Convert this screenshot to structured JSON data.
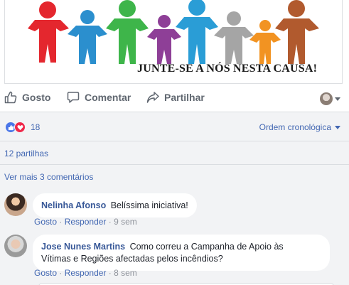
{
  "post": {
    "image_caption": "JUNTE-SE A NÓS NESTA CAUSA!"
  },
  "actions": {
    "like_label": "Gosto",
    "comment_label": "Comentar",
    "share_label": "Partilhar"
  },
  "reactions": {
    "count": "18",
    "order_label": "Ordem cronológica"
  },
  "shares": {
    "label": "12 partilhas"
  },
  "comments": {
    "more_label": "Ver mais 3 comentários",
    "items": [
      {
        "author": "Nelinha Afonso",
        "text": "Belíssima iniciativa!",
        "like_label": "Gosto",
        "reply_label": "Responder",
        "time": "9 sem"
      },
      {
        "author": "Jose Nunes Martins",
        "text_line1": "Como correu a Campanha de Apoio às",
        "text_line2": "Vítimas e Regiões afectadas pelos incêndios?",
        "like_label": "Gosto",
        "reply_label": "Responder",
        "time": "8 sem"
      }
    ]
  },
  "colors": {
    "link": "#4267b2",
    "author": "#385898",
    "action_gray": "#606770",
    "background_gray": "#f2f3f5",
    "like_blue": "#4a76e8",
    "love_red": "#f0284a"
  },
  "icons": [
    "thumbs-up-icon",
    "comment-icon",
    "share-icon",
    "chevron-down-icon",
    "like-reaction-icon",
    "love-reaction-icon"
  ]
}
